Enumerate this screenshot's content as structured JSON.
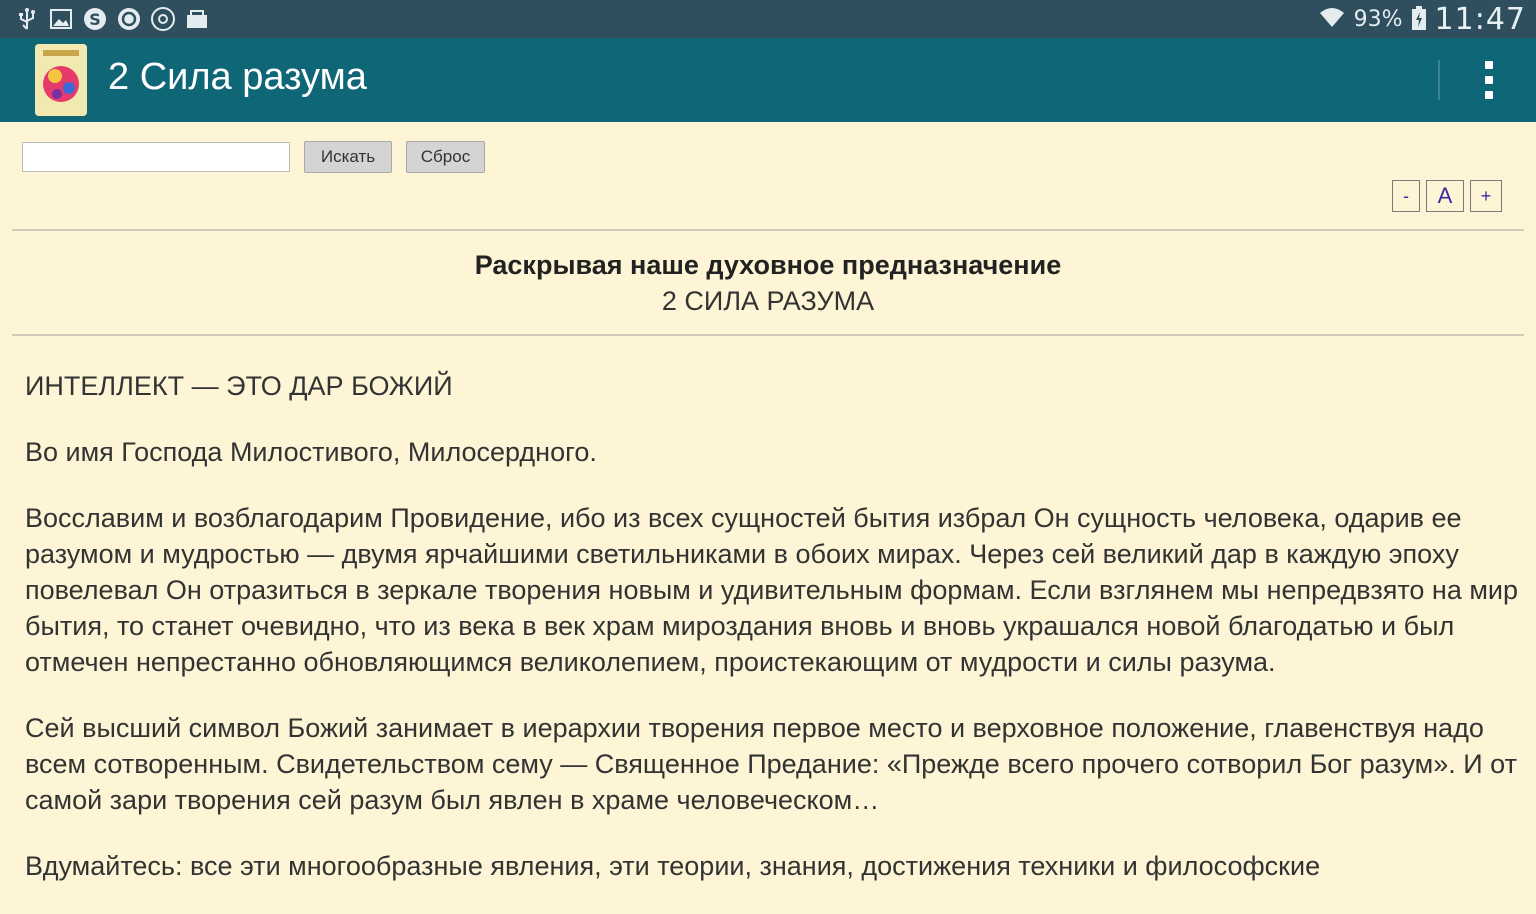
{
  "status_bar": {
    "icons": [
      "usb-icon",
      "image-icon",
      "skype-icon",
      "sync-icon",
      "media-icon",
      "mail-icon"
    ],
    "battery": "93%",
    "time": "11:47"
  },
  "toolbar": {
    "title": "2 Сила разума",
    "menu_icon": "overflow-menu-icon"
  },
  "search": {
    "placeholder": "",
    "value": "",
    "search_label": "Искать",
    "reset_label": "Сброс"
  },
  "font_controls": {
    "decrease": "-",
    "default": "A",
    "increase": "+"
  },
  "header": {
    "book_title": "Раскрывая наше духовное предназначение",
    "chapter_title": "2 СИЛА РАЗУМА"
  },
  "content": {
    "section_heading": "ИНТЕЛЛЕКТ — ЭТО ДАР БОЖИЙ",
    "paragraphs": [
      "Во имя Господа Милостивого, Милосердного.",
      "Восславим и возблагодарим Провидение, ибо из всех сущностей бытия избрал Он сущность человека, одарив ее разумом и мудростью — двумя ярчайшими светильниками в обоих мирах. Через сей великий дар в каждую эпоху повелевал Он отразиться в зеркале творения новым и удивительным формам. Если взглянем мы непредвзято на мир бытия, то станет очевидно, что из века в век храм мироздания вновь и вновь украшался новой благодатью и был отмечен непрестанно обновляющимся великолепием, проистекающим от мудрости и силы разума.",
      "Сей высший символ Божий занимает в иерархии творения первое место и верховное положение, главенствуя надо всем сотворенным. Свидетельством сему — Священное Предание: «Прежде всего прочего сотворил Бог разум». И от самой зари творения сей разум был явлен в храме человеческом…",
      "Вдумайтесь: все эти многообразные явления, эти теории, знания, достижения техники и философские"
    ]
  },
  "colors": {
    "status_bar": "#2f4f5e",
    "toolbar": "#0e6677",
    "background": "#fdf5d6",
    "font_button_text": "#3a2c9e"
  }
}
